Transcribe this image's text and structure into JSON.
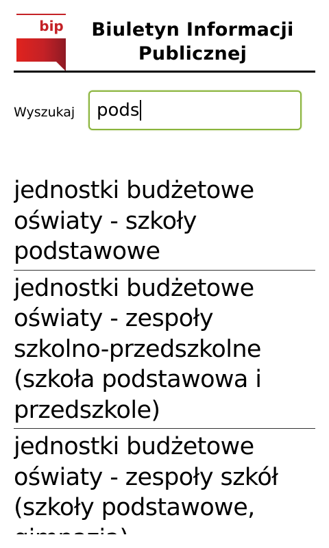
{
  "header": {
    "logo_text": "bip",
    "title_line1": "Biuletyn Informacji",
    "title_line2": "Publicznej"
  },
  "search": {
    "label": "Wyszukaj",
    "value": "pods"
  },
  "results": [
    "jednostki budżetowe oświaty - szkoły podstawowe",
    "jednostki budżetowe oświaty - zespoły szkolno-przedszkolne (szkoła podstawowa i przedszkole)",
    "jednostki budżetowe oświaty - zespoły szkół (szkoły podstawowe, gimnazja)"
  ],
  "colors": {
    "logo_red": "#d42a25",
    "input_border": "#8ab43c"
  }
}
